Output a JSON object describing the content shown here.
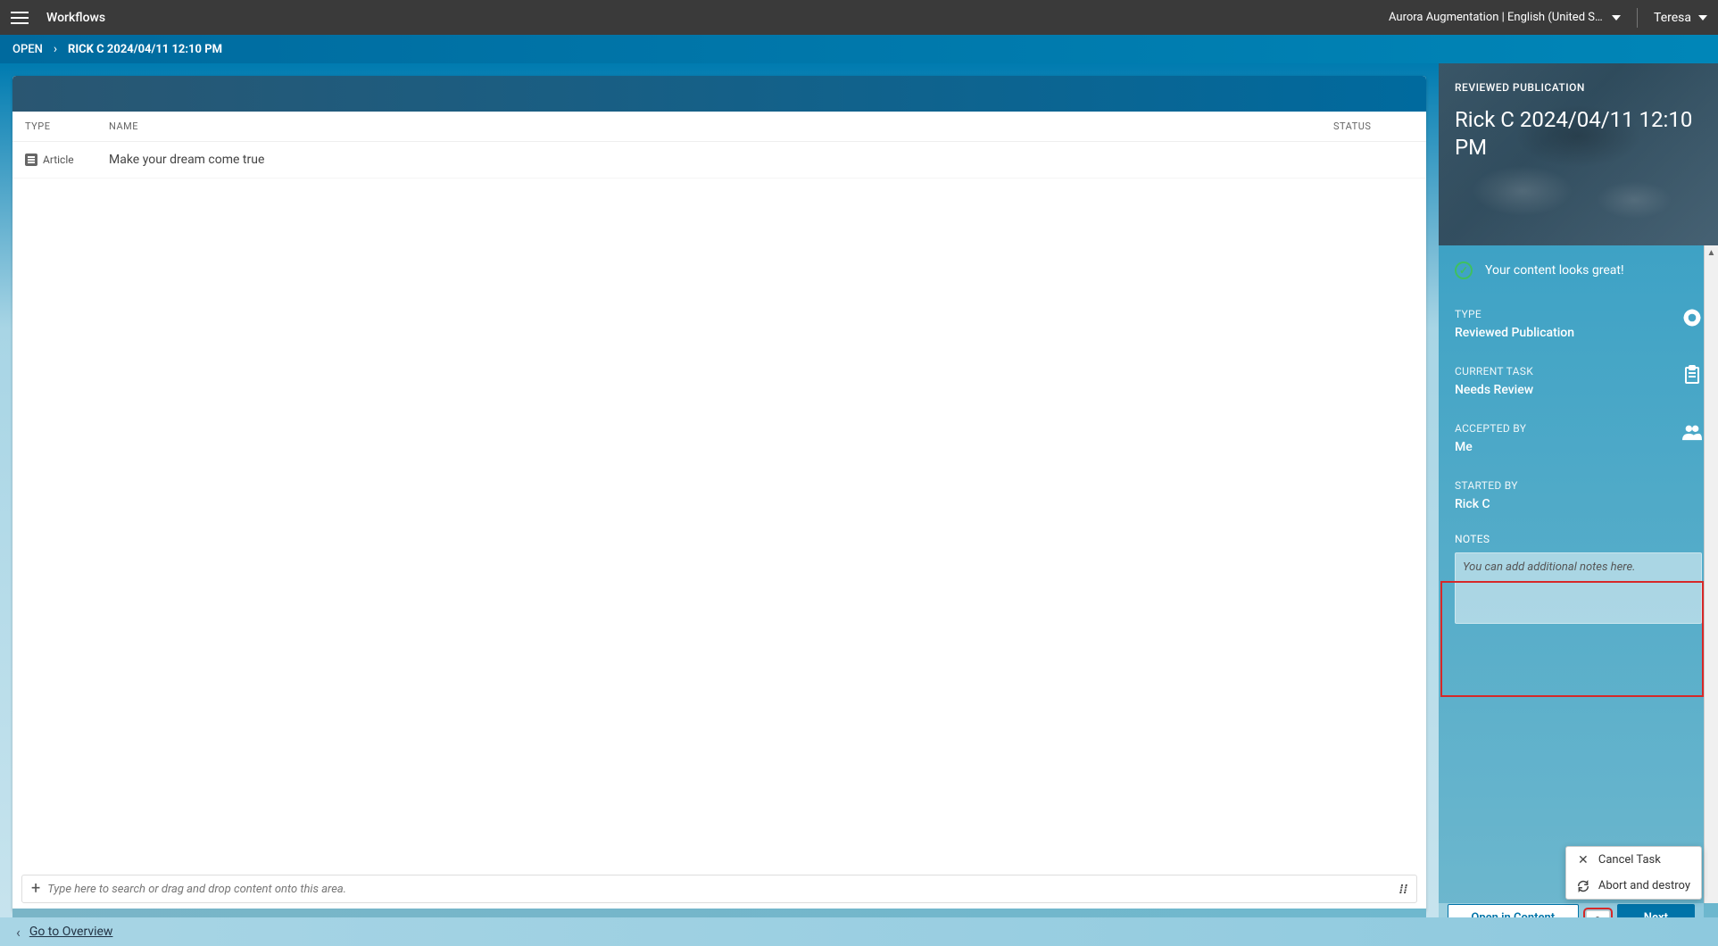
{
  "topbar": {
    "app_title": "Workflows",
    "site": "Aurora Augmentation | English (United St...",
    "user": "Teresa"
  },
  "breadcrumb": {
    "root": "OPEN",
    "current": "RICK C 2024/04/11 12:10 PM"
  },
  "table": {
    "headers": {
      "type": "TYPE",
      "name": "NAME",
      "status": "STATUS"
    },
    "rows": [
      {
        "type": "Article",
        "name": "Make your dream come true",
        "status": ""
      }
    ],
    "search_placeholder": "Type here to search or drag and drop content onto this area."
  },
  "bottom": {
    "overview_link": "Go to Overview"
  },
  "sidebar": {
    "hero_label": "REVIEWED PUBLICATION",
    "hero_title": "Rick C 2024/04/11 12:10 PM",
    "status_message": "Your content looks great!",
    "type_label": "TYPE",
    "type_value": "Reviewed Publication",
    "task_label": "CURRENT TASK",
    "task_value": "Needs Review",
    "accepted_label": "ACCEPTED BY",
    "accepted_value": "Me",
    "started_label": "STARTED BY",
    "started_value": "Rick C",
    "notes_label": "NOTES",
    "notes_placeholder": "You can add additional notes here."
  },
  "footer": {
    "open_content": "Open in Content App",
    "next_step": "Next Step"
  },
  "menu": {
    "cancel": "Cancel Task",
    "abort": "Abort and destroy"
  }
}
